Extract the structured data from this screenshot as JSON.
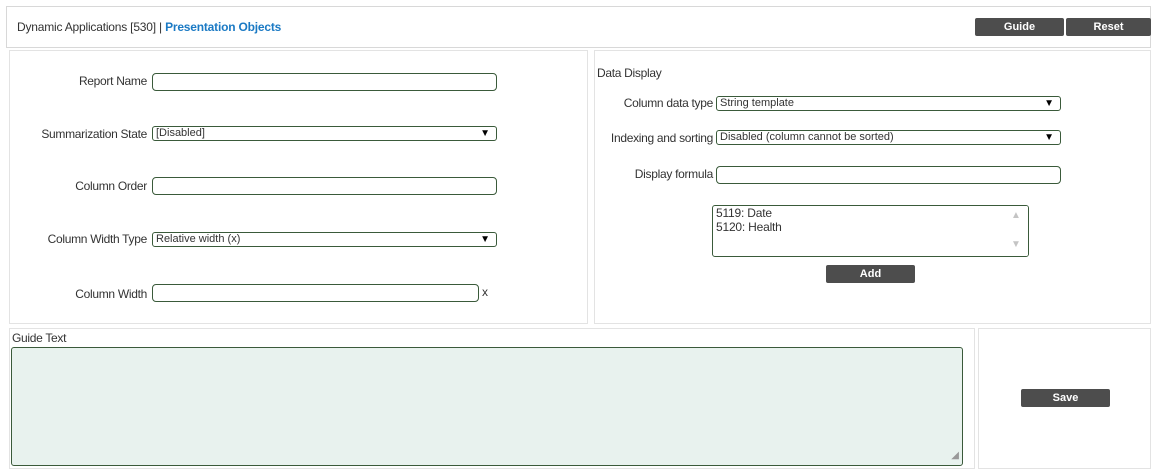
{
  "header": {
    "title_prefix": "Dynamic Applications [530] | ",
    "title_link": "Presentation Objects",
    "guide_label": "Guide",
    "reset_label": "Reset"
  },
  "form": {
    "report_name": {
      "label": "Report Name",
      "value": ""
    },
    "summarization_state": {
      "label": "Summarization State",
      "value": "[Disabled]"
    },
    "column_order": {
      "label": "Column Order",
      "value": ""
    },
    "column_width_type": {
      "label": "Column Width Type",
      "value": "Relative width (x)"
    },
    "column_width": {
      "label": "Column Width",
      "value": "",
      "suffix": "x"
    }
  },
  "data_display": {
    "heading": "Data Display",
    "column_data_type": {
      "label": "Column data type",
      "value": "String template"
    },
    "indexing_sorting": {
      "label": "Indexing and sorting",
      "value": "Disabled (column cannot be sorted)"
    },
    "display_formula": {
      "label": "Display formula",
      "value": ""
    },
    "objects": [
      "5119: Date",
      "5120: Health"
    ],
    "add_label": "Add"
  },
  "guide": {
    "label": "Guide Text",
    "value": ""
  },
  "save_label": "Save",
  "colors": {
    "accent_link": "#1b7ac4",
    "button_dark": "#4d4d4d",
    "field_border": "#3a5a3a",
    "textarea_bg": "#e8f2ee"
  }
}
